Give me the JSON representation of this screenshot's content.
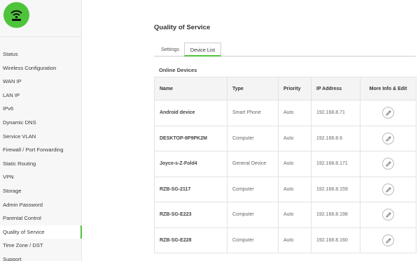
{
  "brand": {
    "accent": "#4ec43a"
  },
  "sidebar": {
    "items": [
      {
        "label": "Status"
      },
      {
        "label": "Wireless Configuration"
      },
      {
        "label": "WAN IP"
      },
      {
        "label": "LAN IP"
      },
      {
        "label": "IPv6"
      },
      {
        "label": "Dynamic DNS"
      },
      {
        "label": "Service VLAN"
      },
      {
        "label": "Firewall / Port Forwarding"
      },
      {
        "label": "Static Routing"
      },
      {
        "label": "VPN"
      },
      {
        "label": "Storage"
      },
      {
        "label": "Admin Password"
      },
      {
        "label": "Parental Control"
      },
      {
        "label": "Quality of Service",
        "active": true
      },
      {
        "label": "Time Zone / DST"
      },
      {
        "label": "Support"
      }
    ]
  },
  "main": {
    "title": "Quality of Service",
    "tabs": [
      {
        "label": "Settings",
        "active": false
      },
      {
        "label": "Device List",
        "active": true
      }
    ],
    "section_title": "Online Devices",
    "table": {
      "headers": [
        "Name",
        "Type",
        "Priority",
        "IP Address",
        "More Info & Edit"
      ],
      "rows": [
        {
          "name": "Android device",
          "type": "Smart Phone",
          "priority": "Auto",
          "ip": "192.168.8.71"
        },
        {
          "name": "DESKTOP-9P9PK2M",
          "type": "Computer",
          "priority": "Auto",
          "ip": "192.168.8.6"
        },
        {
          "name": "Joyce-s-Z-Fold4",
          "type": "General Device",
          "priority": "Auto",
          "ip": "192.168.8.171"
        },
        {
          "name": "RZB-SG-2117",
          "type": "Computer",
          "priority": "Auto",
          "ip": "192.168.8.159"
        },
        {
          "name": "RZB-SG-E223",
          "type": "Computer",
          "priority": "Auto",
          "ip": "192.168.8.198"
        },
        {
          "name": "RZB-SG-E228",
          "type": "Computer",
          "priority": "Auto",
          "ip": "192.168.8.160"
        }
      ]
    }
  },
  "icons": {
    "logo": "wifi-router-icon",
    "edit": "pencil-icon"
  }
}
